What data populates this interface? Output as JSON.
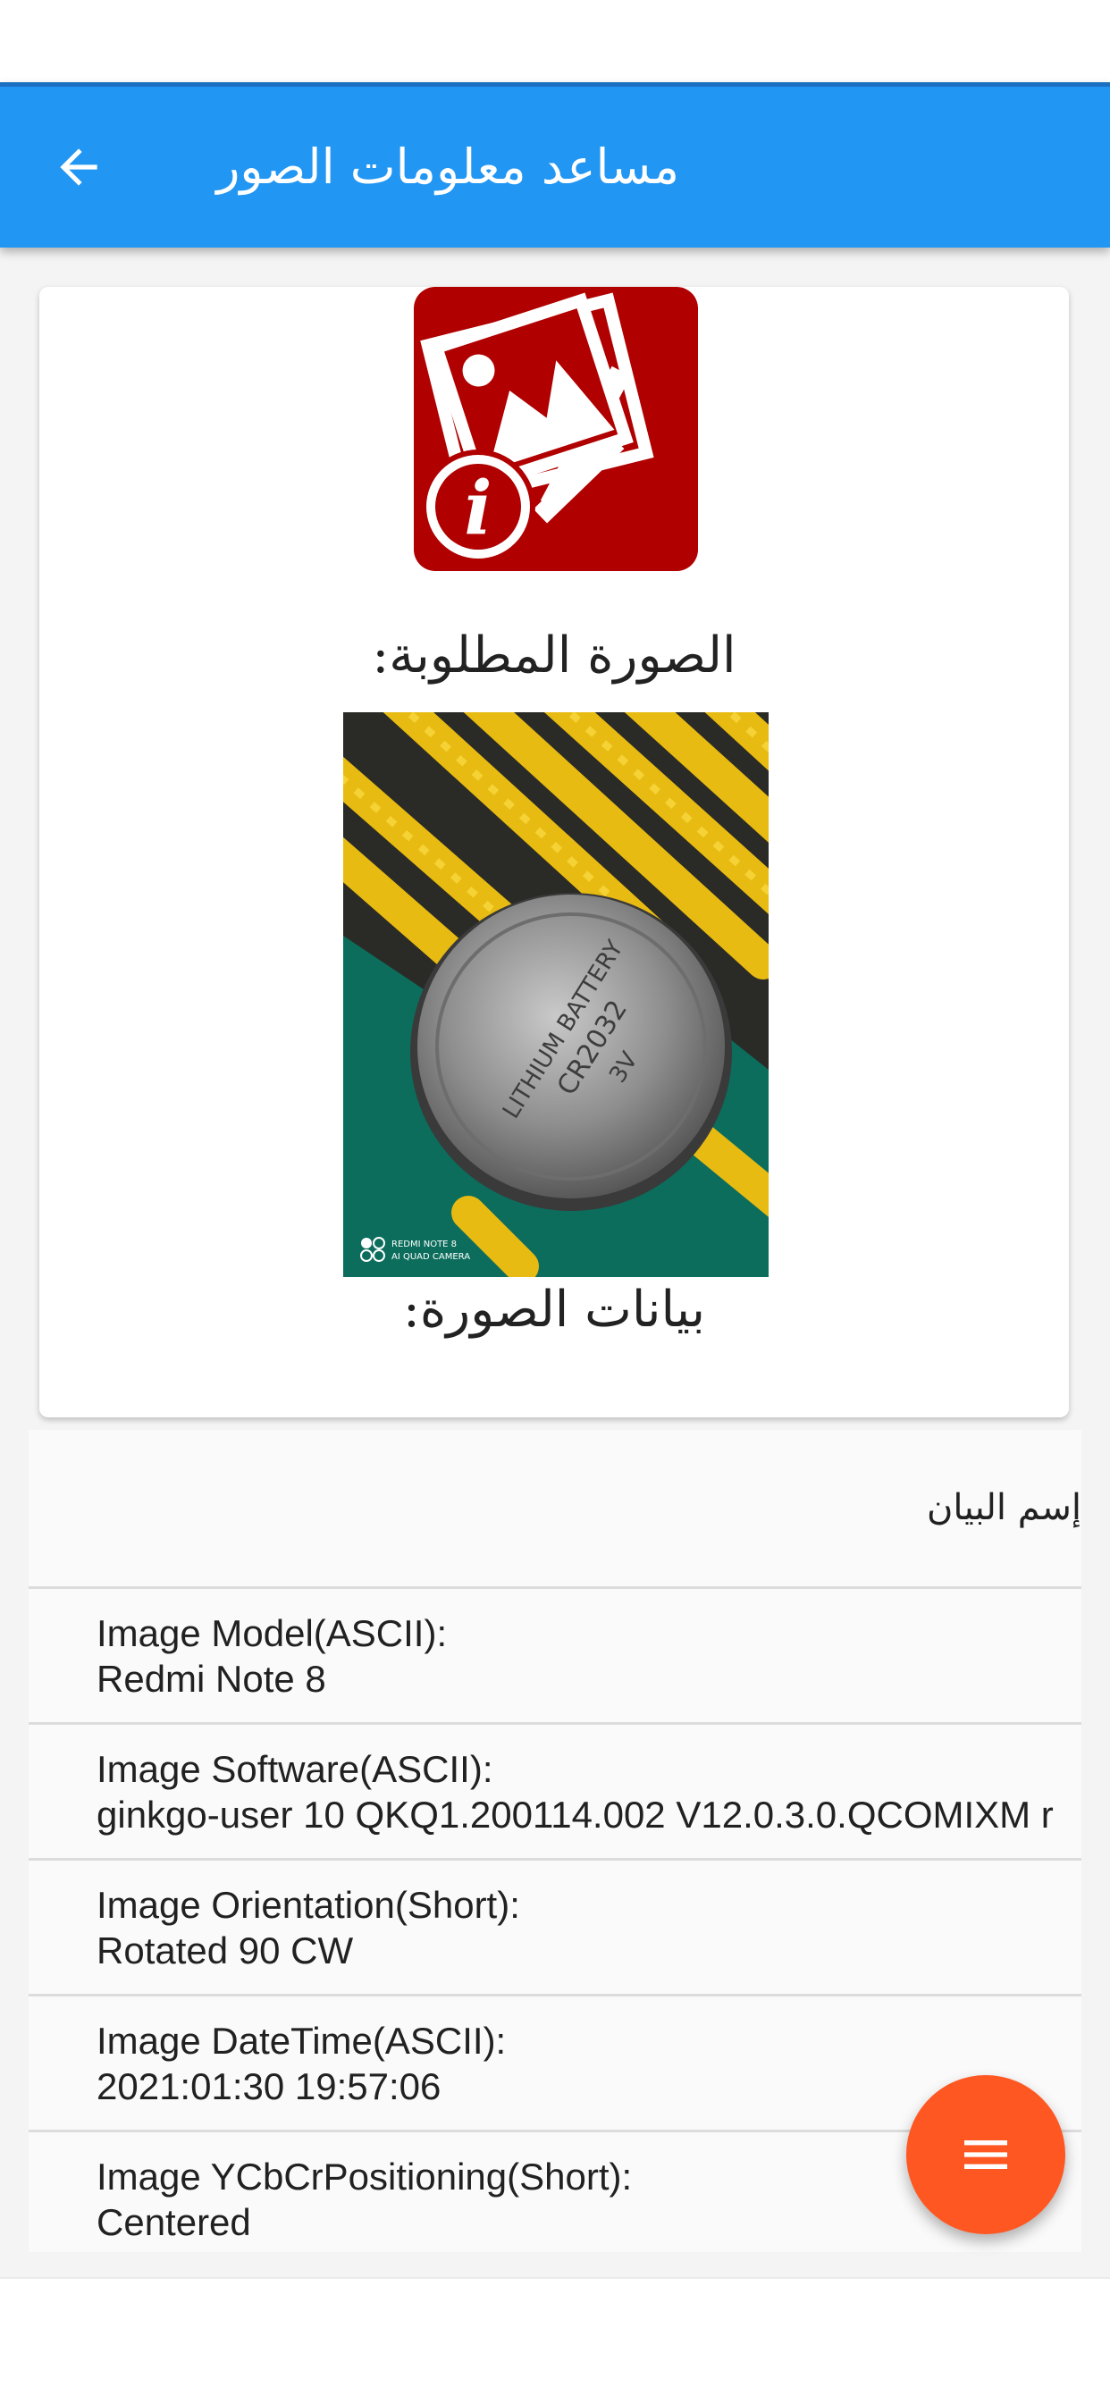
{
  "app_bar": {
    "title": "مساعد معلومات الصور",
    "back_icon": "arrow-left-icon",
    "color": "#2196f3"
  },
  "card": {
    "logo_icon": "photo-info-icon",
    "logo_color": "#b00000",
    "requested_image_label": "الصورة المطلوبة:",
    "photo_watermark_line1": "REDMI NOTE 8",
    "photo_watermark_line2": "AI QUAD CAMERA",
    "battery_text_1": "LITHIUM BATTERY",
    "battery_text_2": "CR2032",
    "battery_text_3": "3V",
    "image_data_label": "بيانات الصورة:"
  },
  "list": {
    "header": "إسم البيان",
    "rows": [
      {
        "title": "Image Model(ASCII):",
        "value": "Redmi Note 8"
      },
      {
        "title": "Image Software(ASCII):",
        "value": "ginkgo-user 10 QKQ1.200114.002 V12.0.3.0.QCOMIXM r"
      },
      {
        "title": "Image Orientation(Short):",
        "value": "Rotated 90 CW"
      },
      {
        "title": "Image DateTime(ASCII):",
        "value": "2021:01:30 19:57:06"
      },
      {
        "title": "Image YCbCrPositioning(Short):",
        "value": "Centered"
      }
    ]
  },
  "fab": {
    "icon": "menu-icon",
    "color": "#ff5722"
  }
}
